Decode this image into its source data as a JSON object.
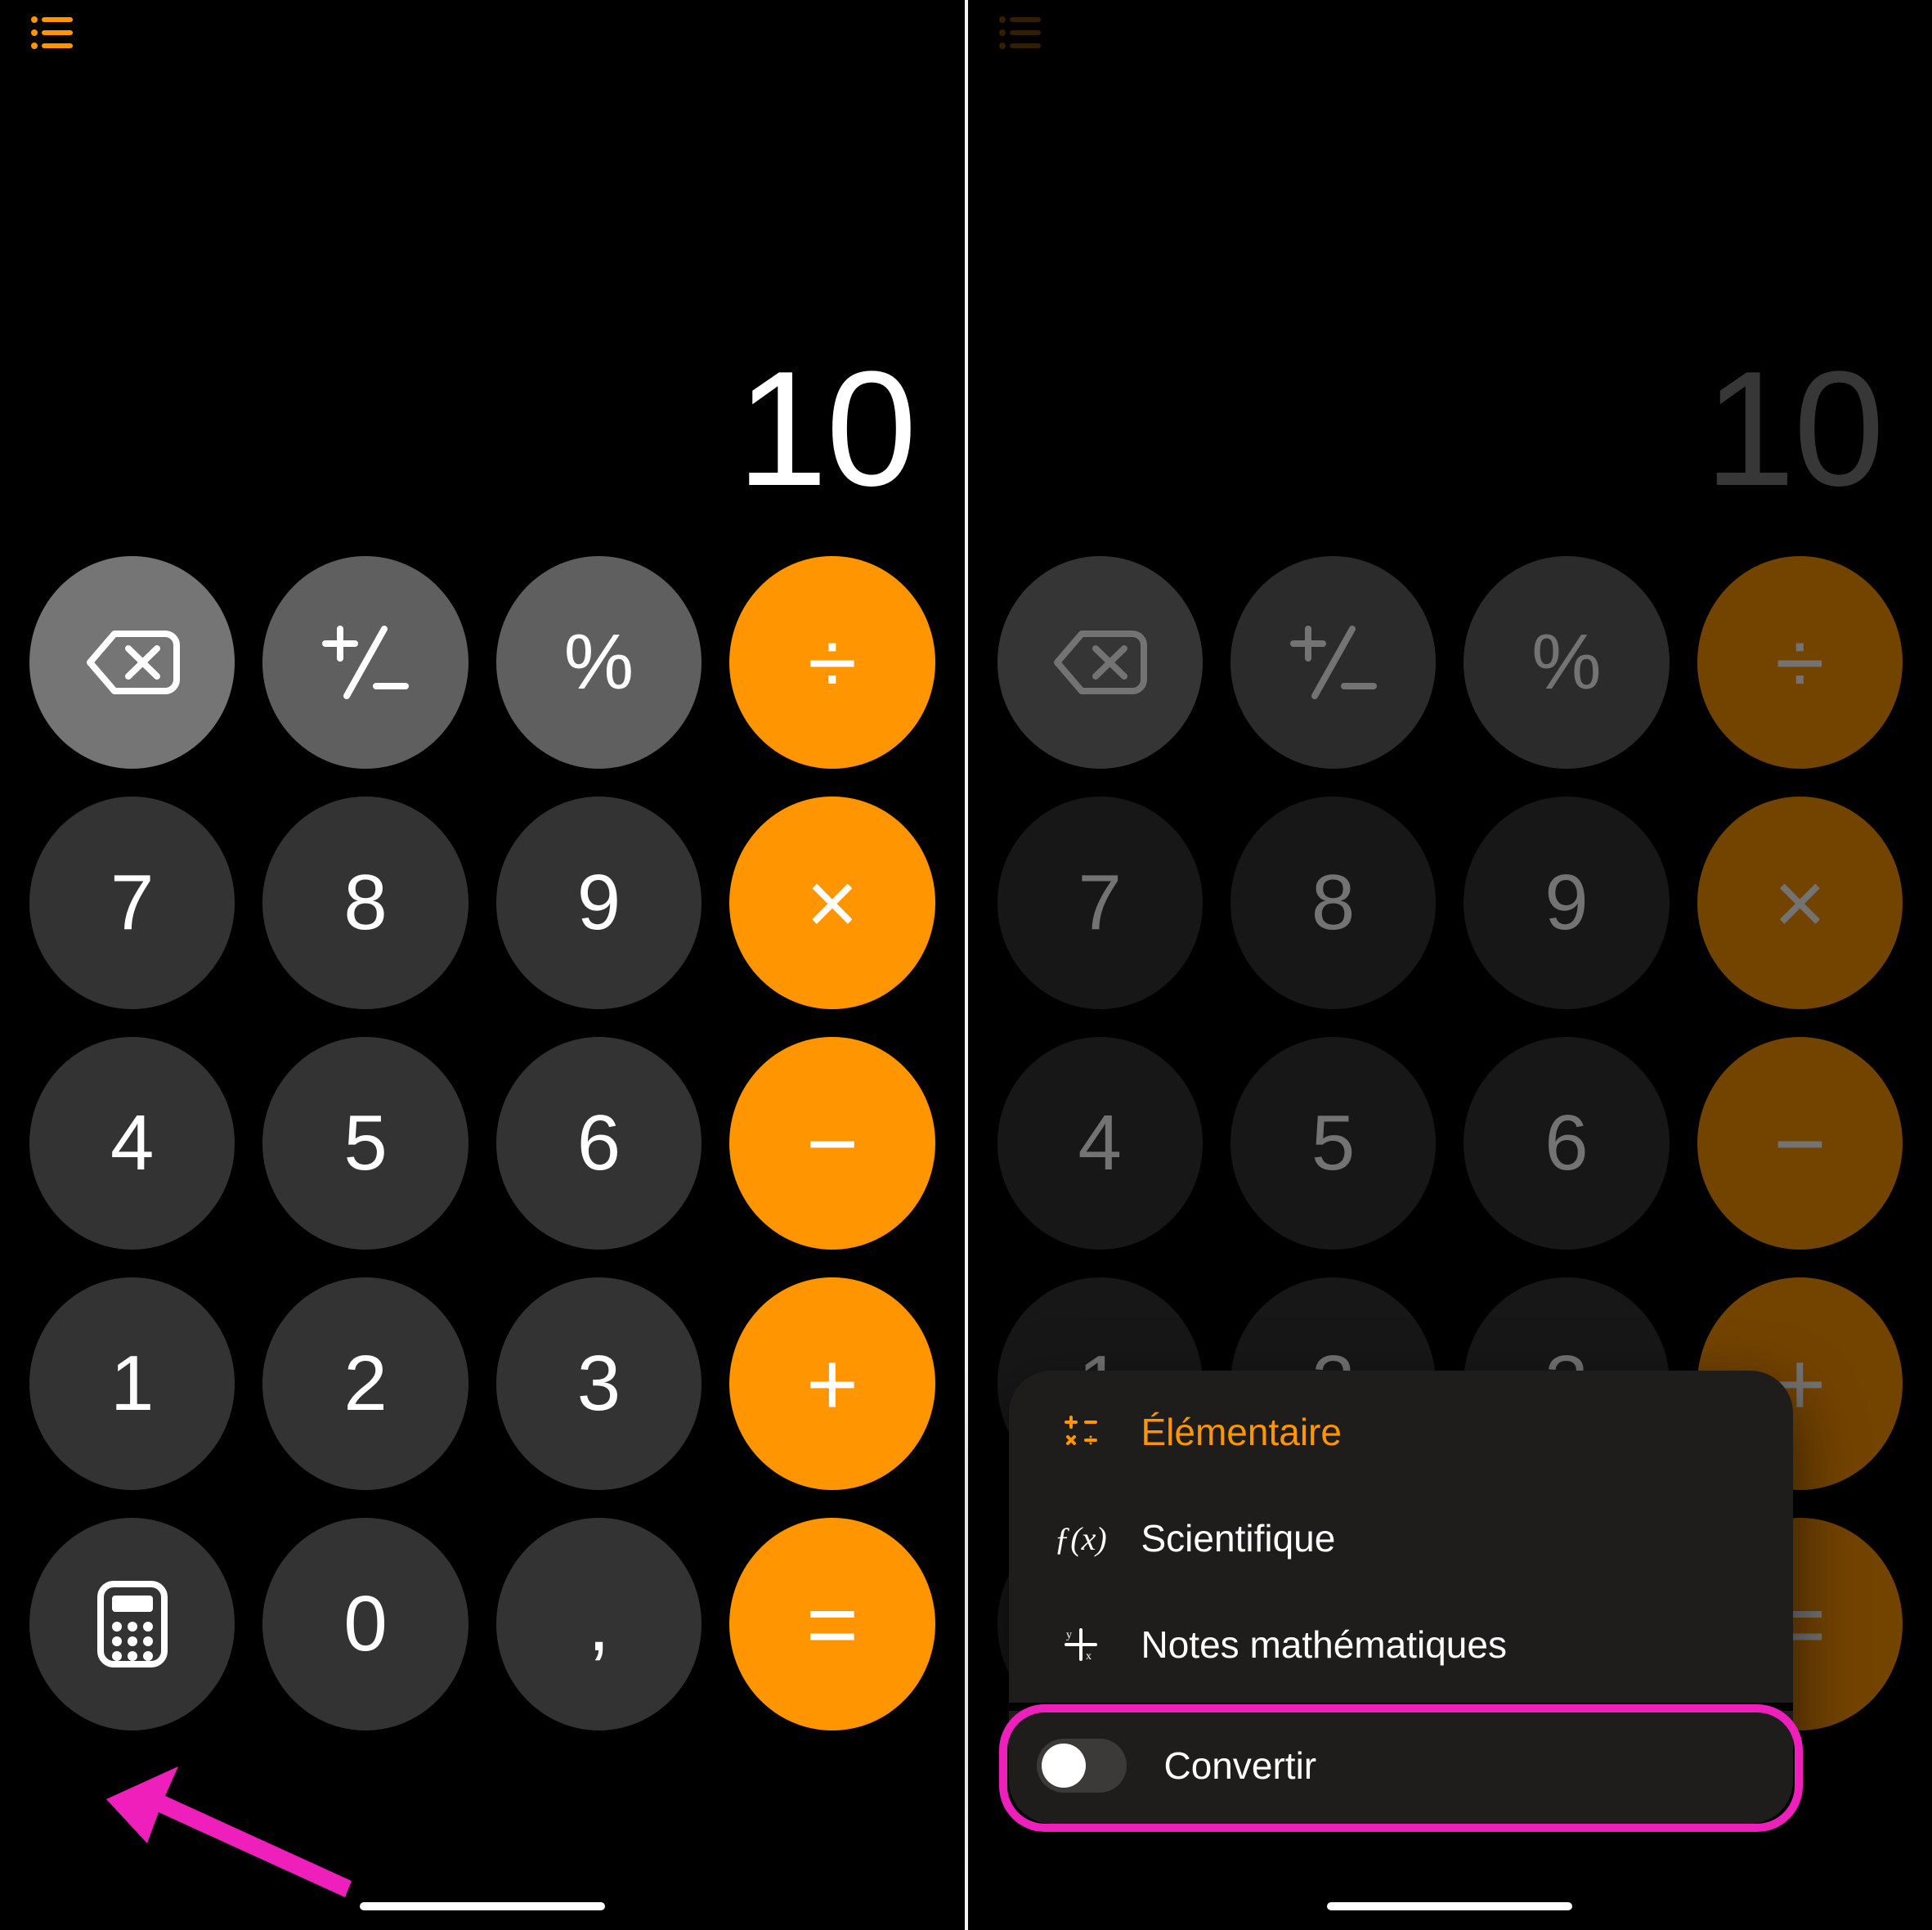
{
  "colors": {
    "accent": "#ff9500",
    "annotation": "#ef1fbb",
    "fnKey": "#5f5f5f",
    "numKey": "#333333",
    "opKey": "#ff9500",
    "bg": "#000000"
  },
  "left": {
    "display": "10",
    "keys": {
      "row0": [
        "backspace",
        "plusminus",
        "percent",
        "divide"
      ],
      "row1": [
        "7",
        "8",
        "9",
        "multiply"
      ],
      "row2": [
        "4",
        "5",
        "6",
        "minus"
      ],
      "row3": [
        "1",
        "2",
        "3",
        "plus"
      ],
      "row4": [
        "mode",
        "0",
        ",",
        "equals"
      ]
    },
    "labels": {
      "percent": "%",
      "divide": "÷",
      "multiply": "×",
      "minus": "−",
      "plus": "+",
      "equals": "=",
      "decimal": ",",
      "d7": "7",
      "d8": "8",
      "d9": "9",
      "d4": "4",
      "d5": "5",
      "d6": "6",
      "d1": "1",
      "d2": "2",
      "d3": "3",
      "d0": "0"
    }
  },
  "right": {
    "display": "10",
    "menu": {
      "items": [
        {
          "id": "basic",
          "label": "Élémentaire",
          "active": true
        },
        {
          "id": "scientific",
          "label": "Scientifique",
          "active": false
        },
        {
          "id": "mathnotes",
          "label": "Notes mathématiques",
          "active": false
        }
      ],
      "toggle": {
        "id": "convert",
        "label": "Convertir",
        "on": false
      }
    }
  }
}
